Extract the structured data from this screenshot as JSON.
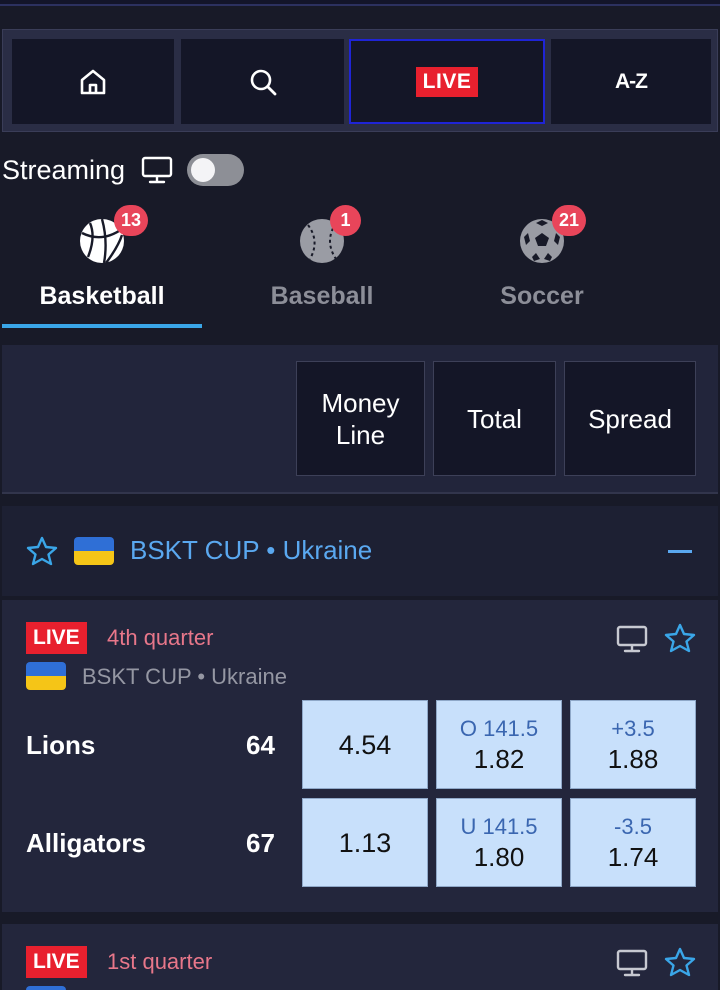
{
  "nav": {
    "home_icon": "home-icon",
    "search_icon": "search-icon",
    "live_label": "LIVE",
    "az_label": "A-Z"
  },
  "streaming": {
    "label": "Streaming",
    "enabled": false
  },
  "sports": [
    {
      "name": "Basketball",
      "count": "13",
      "active": true,
      "icon": "basketball-icon"
    },
    {
      "name": "Baseball",
      "count": "1",
      "active": false,
      "icon": "baseball-icon"
    },
    {
      "name": "Soccer",
      "count": "21",
      "active": false,
      "icon": "soccer-ball-icon"
    }
  ],
  "markets": {
    "money_line": "Money Line",
    "total": "Total",
    "spread": "Spread"
  },
  "league": {
    "title": "BSKT CUP • Ukraine"
  },
  "matches": [
    {
      "live_label": "LIVE",
      "period": "4th quarter",
      "league": "BSKT CUP • Ukraine",
      "teams": [
        {
          "name": "Lions",
          "score": "64",
          "money_line": "4.54",
          "total_line": "O 141.5",
          "total_price": "1.82",
          "spread_line": "+3.5",
          "spread_price": "1.88"
        },
        {
          "name": "Alligators",
          "score": "67",
          "money_line": "1.13",
          "total_line": "U 141.5",
          "total_price": "1.80",
          "spread_line": "-3.5",
          "spread_price": "1.74"
        }
      ]
    },
    {
      "live_label": "LIVE",
      "period": "1st quarter"
    }
  ],
  "colors": {
    "background": "#181a28",
    "live_red": "#e8202e",
    "accent_blue": "#3aa6e8",
    "league_blue": "#5aa8f0",
    "odds_bg": "#c8e0fb",
    "badge": "#e8455a"
  }
}
